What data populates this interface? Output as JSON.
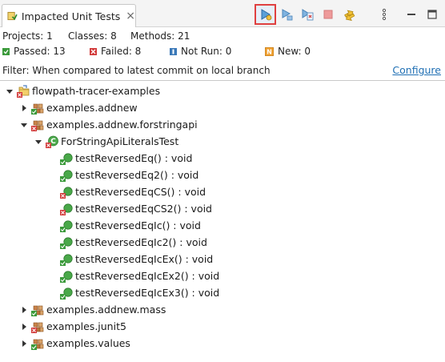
{
  "tab": {
    "title": "Impacted Unit Tests",
    "close": "×"
  },
  "toolbar": {
    "buttons": [
      {
        "icon": "run-impacted-tests-icon",
        "active": true
      },
      {
        "icon": "run-all-icon",
        "active": false
      },
      {
        "icon": "run-failed-icon",
        "active": false
      },
      {
        "icon": "stop-icon",
        "active": false
      },
      {
        "icon": "sync-icon",
        "active": false
      },
      {
        "icon": "view-menu-icon",
        "active": false
      },
      {
        "icon": "minimize-icon",
        "active": false
      },
      {
        "icon": "maximize-icon",
        "active": false
      }
    ],
    "view_menu": "⋮"
  },
  "stats": {
    "projects": "Projects: 1",
    "classes": "Classes: 8",
    "methods": "Methods: 21",
    "passed": "Passed: 13",
    "failed": "Failed: 8",
    "not_run": "Not Run: 0",
    "new": "New: 0"
  },
  "filter": {
    "text": "Filter: When compared to latest commit on local branch",
    "link": "Configure"
  },
  "tree": [
    {
      "label": "flowpath-tracer-examples",
      "kind": "project",
      "status": "failed",
      "expanded": true,
      "depth": 0
    },
    {
      "label": "examples.addnew",
      "kind": "package",
      "status": "passed",
      "expanded": false,
      "depth": 1
    },
    {
      "label": "examples.addnew.forstringapi",
      "kind": "package",
      "status": "failed",
      "expanded": true,
      "depth": 1
    },
    {
      "label": "ForStringApiLiteralsTest",
      "kind": "class",
      "status": "failed",
      "expanded": true,
      "depth": 2
    },
    {
      "label": "testReversedEq() : void",
      "kind": "method",
      "status": "passed",
      "depth": 3
    },
    {
      "label": "testReversedEq2() : void",
      "kind": "method",
      "status": "passed",
      "depth": 3
    },
    {
      "label": "testReversedEqCS() : void",
      "kind": "method",
      "status": "failed",
      "depth": 3
    },
    {
      "label": "testReversedEqCS2() : void",
      "kind": "method",
      "status": "failed",
      "depth": 3
    },
    {
      "label": "testReversedEqIc() : void",
      "kind": "method",
      "status": "passed",
      "depth": 3
    },
    {
      "label": "testReversedEqIc2() : void",
      "kind": "method",
      "status": "passed",
      "depth": 3
    },
    {
      "label": "testReversedEqIcEx() : void",
      "kind": "method",
      "status": "passed",
      "depth": 3
    },
    {
      "label": "testReversedEqIcEx2() : void",
      "kind": "method",
      "status": "passed",
      "depth": 3
    },
    {
      "label": "testReversedEqIcEx3() : void",
      "kind": "method",
      "status": "passed",
      "depth": 3
    },
    {
      "label": "examples.addnew.mass",
      "kind": "package",
      "status": "passed",
      "expanded": false,
      "depth": 1
    },
    {
      "label": "examples.junit5",
      "kind": "package",
      "status": "failed",
      "expanded": false,
      "depth": 1
    },
    {
      "label": "examples.values",
      "kind": "package",
      "status": "passed",
      "expanded": false,
      "depth": 1
    }
  ],
  "colors": {
    "passed": "#3a9a3a",
    "failed": "#d23a3a",
    "link": "#1f6fb4",
    "active_border": "#e04040"
  }
}
